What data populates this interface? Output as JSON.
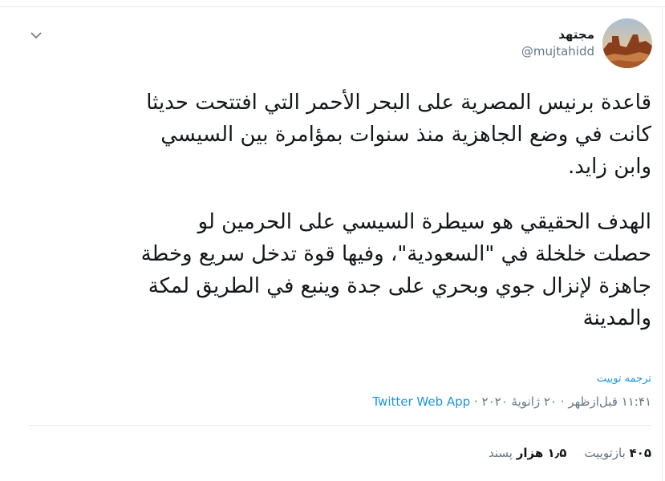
{
  "tweet": {
    "author": {
      "display_name": "مجتهد",
      "handle": "@mujtahidd"
    },
    "paragraphs": [
      "قاعدة برنيس المصرية على البحر الأحمر التي افتتحت حديثا\nكانت في وضع الجاهزية منذ سنوات بمؤامرة بين السيسي\nوابن زايد.",
      "الهدف الحقيقي هو سيطرة السيسي على الحرمين لو\nحصلت خلخلة في \"السعودية\"، وفيها قوة تدخل سريع وخطة\nجاهزة لإنزال جوي وبحري على جدة وينبع في الطريق لمكة\nوالمدينة"
    ],
    "translate_label": "ترجمه توییت",
    "time": "۱۱:۴۱ قبل‌ازظهر",
    "date": "۲۰ ژانویهٔ ۲۰۲۰",
    "separator": "·",
    "source": "Twitter Web App",
    "stats": {
      "retweets_count": "۴۰۵",
      "retweets_label": "بازتوییت",
      "likes_count": "۱٫۵ هزار",
      "likes_label": "پسند"
    }
  },
  "icons": {
    "caret": "chevron-down-icon",
    "avatar": "avatar-image"
  }
}
